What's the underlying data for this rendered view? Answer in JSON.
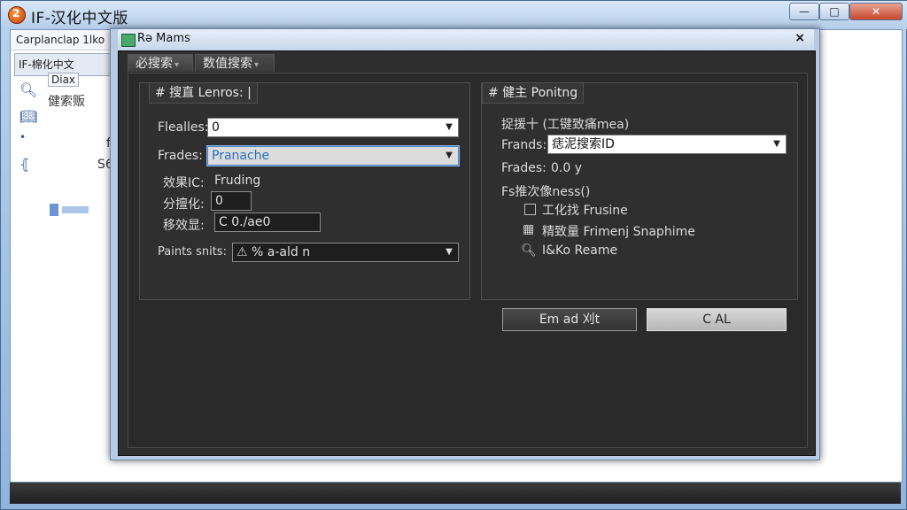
{
  "outer_window": {
    "title": "IF-汉化中文版",
    "min_label": "—",
    "max_label": "□",
    "close_label": "✕",
    "tab1_label": "Carplanclap 1lko",
    "tab2_label": "IF-棉化中文",
    "sidebar": {
      "item1": "Diax",
      "item2": "健索贩",
      "item_f": "f",
      "item_s6": "S6"
    }
  },
  "dialog": {
    "title": "Rə Mams",
    "close_label": "×",
    "tabs": [
      {
        "label": "必搜索"
      },
      {
        "label": "数值搜索"
      }
    ],
    "left_group": {
      "legend": "# 搜直 Lenros: |",
      "fields": {
        "flealles_label": "Flealles:",
        "flealles_value": "0",
        "frades_label": "Frades:",
        "frades_value": "Pranache",
        "xiaoguo_label": "效果IC:",
        "xiaoguo_value": "Fruding",
        "fenhuo_label": "分擅化:",
        "fenhuo_value": "0",
        "yijian_label": "移效显:",
        "yijian_value": "C 0./ae0",
        "paints_label": "Paints snits:",
        "paints_value": "% a-ald n"
      }
    },
    "right_group": {
      "legend": "# 健主 Ponitng",
      "fields": {
        "yuanshu_label": "捉援十 (工键致痛mea)",
        "frands_label": "Frands:",
        "frands_value": "痣泥搜索ID",
        "frades_label": "Frades:",
        "frades_value": "0.0 y",
        "fs_label": "Fs推次像ness()",
        "opt1_label": "工化找 Frusine",
        "opt2_label": "精致量 Frimenj Snaphime",
        "opt3_label": "I&Ko Reame"
      },
      "buttons": {
        "apply": "Em ad 刈t",
        "cancel": "C AL"
      }
    }
  },
  "icons": {
    "app": "app-logo-icon",
    "dialog": "dialog-icon",
    "search": "search-icon"
  }
}
